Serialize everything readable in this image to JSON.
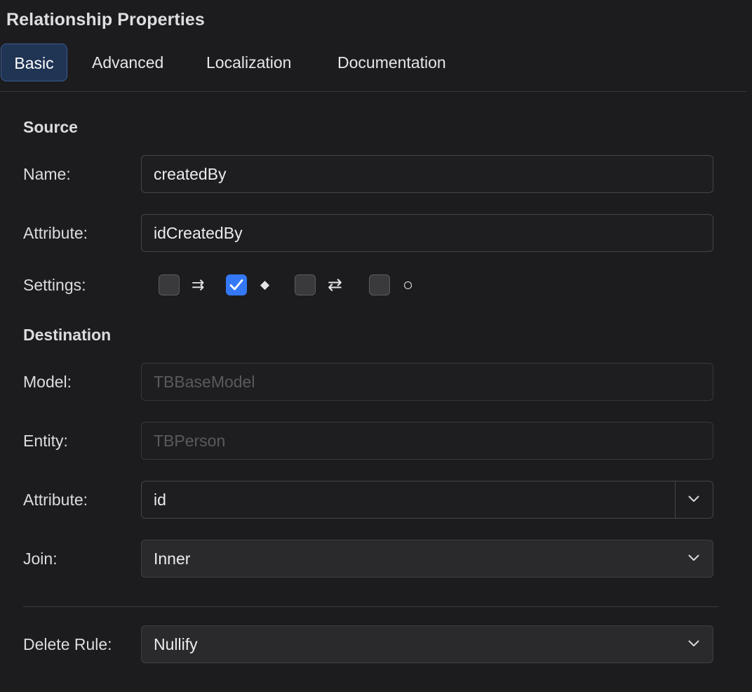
{
  "panel": {
    "title": "Relationship Properties"
  },
  "tabs": [
    {
      "label": "Basic",
      "active": true
    },
    {
      "label": "Advanced",
      "active": false
    },
    {
      "label": "Localization",
      "active": false
    },
    {
      "label": "Documentation",
      "active": false
    }
  ],
  "source": {
    "heading": "Source",
    "name_label": "Name:",
    "name_value": "createdBy",
    "attribute_label": "Attribute:",
    "attribute_value": "idCreatedBy",
    "settings_label": "Settings:",
    "settings": [
      {
        "icon": "double-arrow-right-icon",
        "glyph": "⇉",
        "checked": false
      },
      {
        "icon": "diamond-icon",
        "glyph": "◆",
        "checked": true
      },
      {
        "icon": "swap-arrows-icon",
        "glyph": "⇄",
        "checked": false
      },
      {
        "icon": "circle-icon",
        "glyph": "○",
        "checked": false
      }
    ]
  },
  "destination": {
    "heading": "Destination",
    "model_label": "Model:",
    "model_value": "TBBaseModel",
    "entity_label": "Entity:",
    "entity_value": "TBPerson",
    "attribute_label": "Attribute:",
    "attribute_value": "id",
    "join_label": "Join:",
    "join_value": "Inner"
  },
  "delete_rule": {
    "label": "Delete Rule:",
    "value": "Nullify"
  },
  "colors": {
    "background": "#1c1c1e",
    "accent": "#3478f6",
    "active_tab": "#203454"
  }
}
